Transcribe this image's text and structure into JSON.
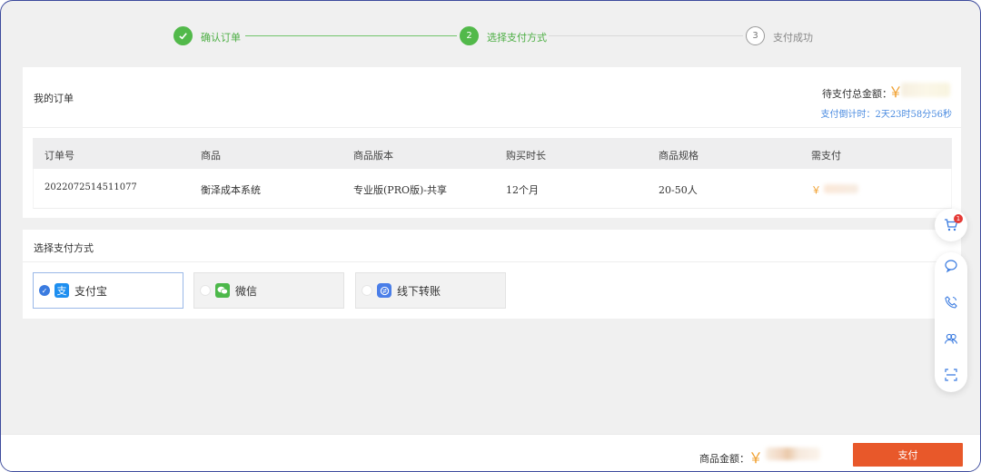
{
  "steps": [
    {
      "label": "确认订单",
      "state": "done"
    },
    {
      "label": "选择支付方式",
      "number": "2",
      "state": "active"
    },
    {
      "label": "支付成功",
      "number": "3",
      "state": "todo"
    }
  ],
  "order": {
    "title": "我的订单",
    "total_label": "待支付总金额：",
    "currency": "￥",
    "countdown": "支付倒计时：2天23时58分56秒",
    "columns": [
      "订单号",
      "商品",
      "商品版本",
      "购买时长",
      "商品规格",
      "需支付"
    ],
    "rows": [
      [
        "2022072514511077",
        "衡泽成本系统",
        "专业版(PRO版)-共享",
        "12个月",
        "20-50人",
        "￥"
      ]
    ]
  },
  "payment": {
    "title": "选择支付方式",
    "methods": [
      {
        "label": "支付宝",
        "icon": "alipay-icon",
        "selected": true
      },
      {
        "label": "微信",
        "icon": "wechat-icon",
        "selected": false
      },
      {
        "label": "线下转账",
        "icon": "offline-transfer-icon",
        "selected": false
      }
    ]
  },
  "sidebar": {
    "cart_badge": "1",
    "icons": [
      "cart-icon",
      "chat-icon",
      "phone-icon",
      "group-icon",
      "scan-icon"
    ]
  },
  "footer": {
    "amount_label": "商品金额：",
    "currency": "￥",
    "pay_button": "支付"
  },
  "colors": {
    "accent_green": "#52b94a",
    "price_orange": "#f0a030",
    "pay_button": "#e8582a",
    "countdown_blue": "#4a8be0",
    "frame_border": "#3c4a9c"
  }
}
